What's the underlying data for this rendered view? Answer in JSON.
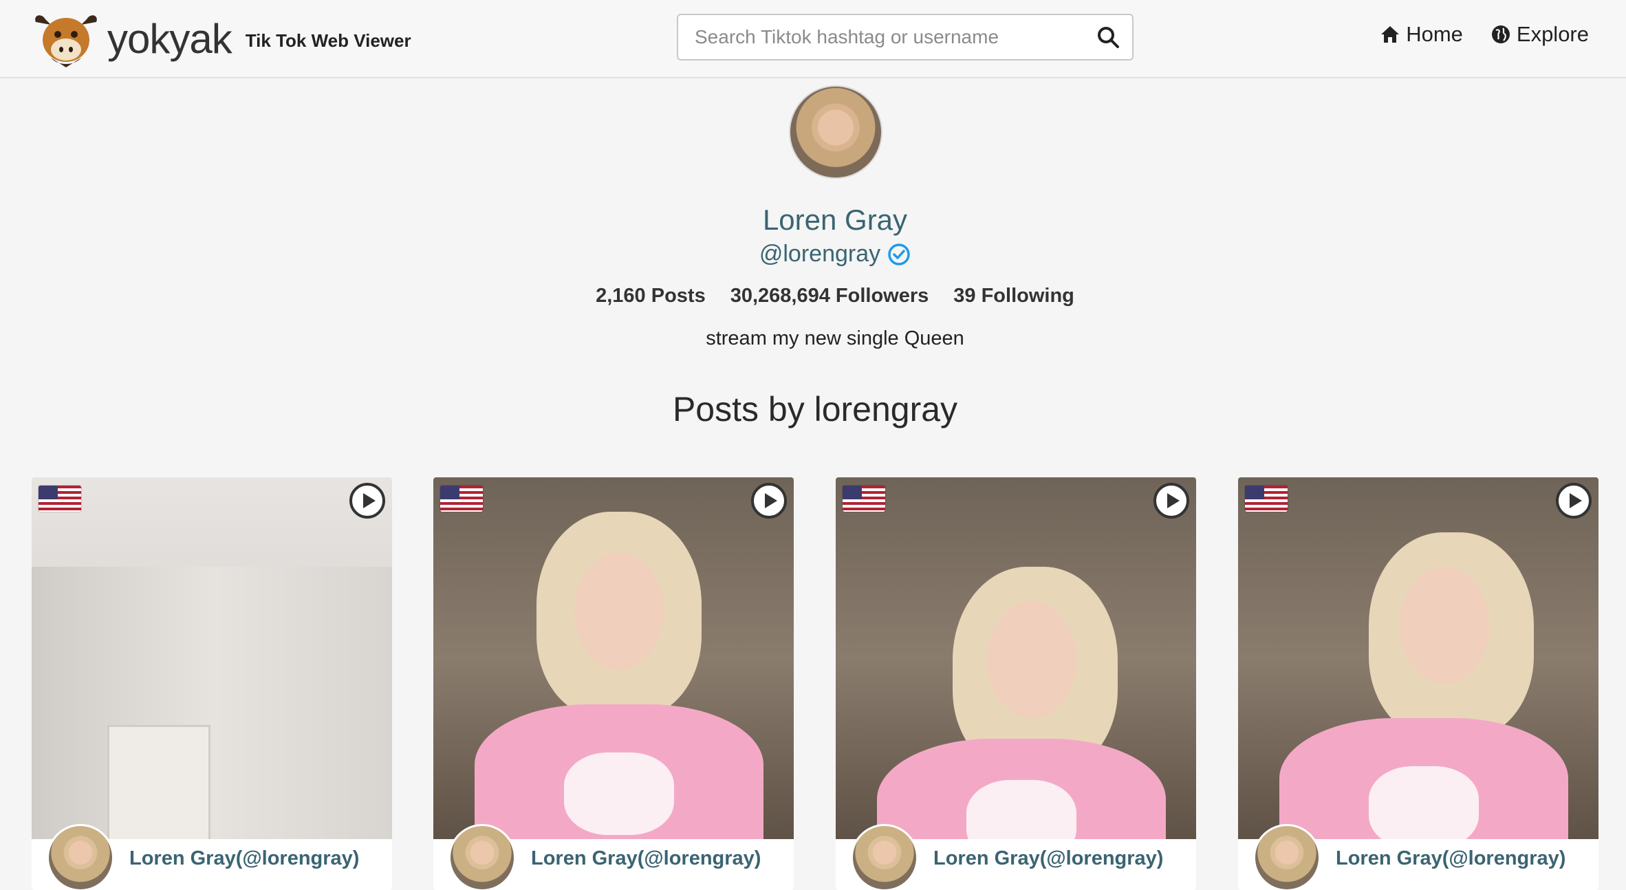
{
  "header": {
    "brand": "yokyak",
    "subtitle": "Tik Tok Web Viewer",
    "search_placeholder": "Search Tiktok hashtag or username",
    "nav": [
      {
        "label": "Home",
        "icon": "home-icon"
      },
      {
        "label": "Explore",
        "icon": "globe-icon"
      }
    ]
  },
  "profile": {
    "name": "Loren Gray",
    "handle": "@lorengray",
    "verified": true,
    "stats": {
      "posts": "2,160 Posts",
      "followers": "30,268,694 Followers",
      "following": "39 Following"
    },
    "bio": "stream my new single Queen"
  },
  "posts_section": {
    "title": "Posts by lorengray",
    "cards": [
      {
        "author": "Loren Gray(@lorengray)",
        "flag": "us-flag-icon"
      },
      {
        "author": "Loren Gray(@lorengray)",
        "flag": "us-flag-icon"
      },
      {
        "author": "Loren Gray(@lorengray)",
        "flag": "us-flag-icon"
      },
      {
        "author": "Loren Gray(@lorengray)",
        "flag": "us-flag-icon"
      }
    ]
  },
  "colors": {
    "accent": "#3a6472",
    "verified": "#1e9be9",
    "background": "#f5f5f5"
  }
}
